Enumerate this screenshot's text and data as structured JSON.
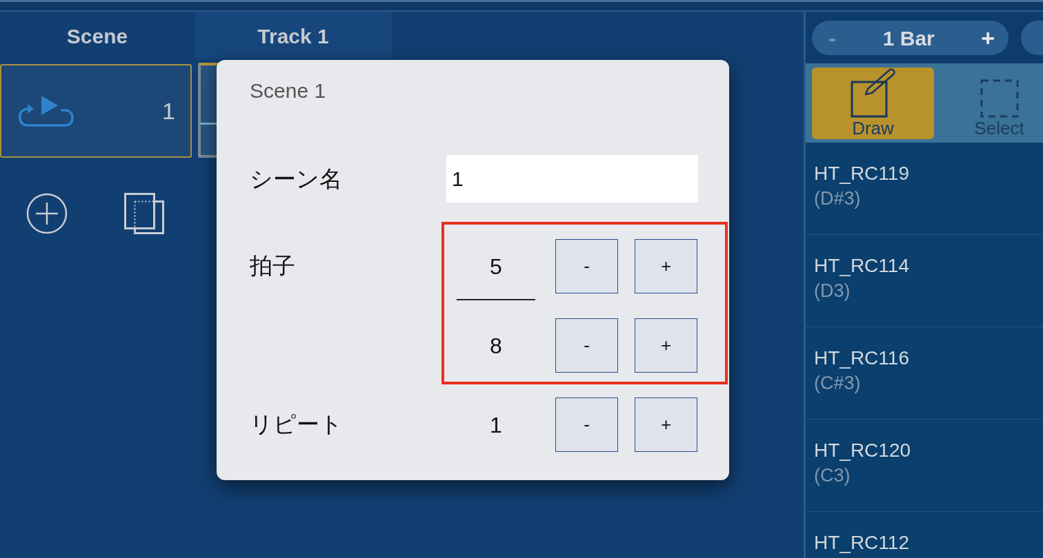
{
  "grid": {
    "columns": [
      {
        "label": "Scene",
        "kind": "scene"
      },
      {
        "label": "Track 1",
        "kind": "track"
      }
    ],
    "scene": {
      "number": "1",
      "selected": true
    }
  },
  "side_panel": {
    "length": {
      "decrement": {
        "label": "-",
        "disabled": true
      },
      "value": "1 Bar",
      "increment": {
        "label": "+",
        "disabled": false
      }
    },
    "tools": [
      {
        "label": "Draw",
        "kind": "draw",
        "selected": true
      },
      {
        "label": "Select",
        "kind": "select",
        "selected": false
      }
    ],
    "instruments": [
      {
        "name": "HT_RC119",
        "note": "(D#3)"
      },
      {
        "name": "HT_RC114",
        "note": "(D3)"
      },
      {
        "name": "HT_RC116",
        "note": "(C#3)"
      },
      {
        "name": "HT_RC120",
        "note": "(C3)"
      },
      {
        "name": "HT_RC112"
      }
    ]
  },
  "dialog": {
    "title": "Scene 1",
    "fields": [
      {
        "kind": "text",
        "label": "シーン名",
        "value": "1"
      },
      {
        "kind": "fraction",
        "label": "拍子",
        "highlighted": true,
        "numerator": {
          "value": "5",
          "decrement": "-",
          "increment": "+"
        },
        "denominator": {
          "value": "8",
          "decrement": "-",
          "increment": "+"
        }
      },
      {
        "kind": "stepper",
        "label": "リピート",
        "highlighted": false,
        "value": "1",
        "decrement": "-",
        "increment": "+"
      }
    ]
  }
}
